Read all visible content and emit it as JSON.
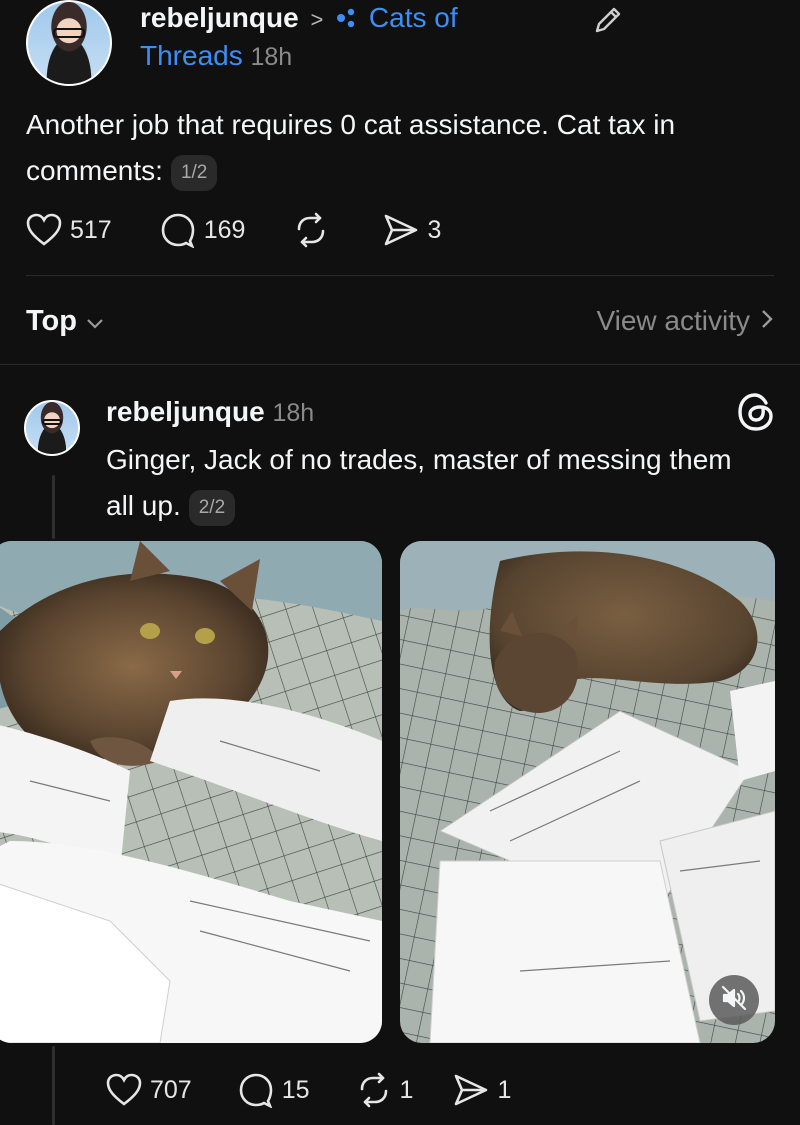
{
  "main_post": {
    "username": "rebeljunque",
    "community_separator": ">",
    "community_name_line1": "Cats of",
    "community_name_line2": "Threads",
    "time": "18h",
    "text": "Another job that requires 0 cat assistance. Cat tax in comments:",
    "page_indicator": "1/2",
    "likes": "517",
    "replies": "169",
    "reposts": "",
    "shares": "3"
  },
  "sort_bar": {
    "label": "Top",
    "view_activity": "View activity"
  },
  "reply_post": {
    "username": "rebeljunque",
    "time": "18h",
    "text": "Ginger, Jack of no trades, master of messing them all up.",
    "page_indicator": "2/2",
    "likes": "707",
    "replies": "15",
    "reposts": "1",
    "shares": "1"
  },
  "colors": {
    "background": "#101010",
    "text": "#f3f5f7",
    "muted": "#8a8a8a",
    "accent": "#3d8ff5"
  },
  "icons": {
    "edit": "pencil-icon",
    "community": "community-dots-icon",
    "like": "heart-icon",
    "reply": "comment-icon",
    "repost": "repost-icon",
    "share": "send-icon",
    "threads": "threads-logo-icon",
    "mute": "muted-speaker-icon",
    "chevron_down": "chevron-down-icon",
    "chevron_right": "chevron-right-icon"
  }
}
